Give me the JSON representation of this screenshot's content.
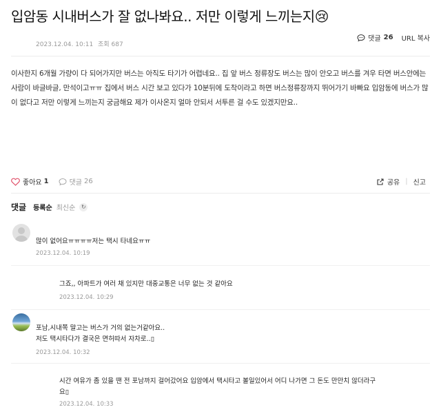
{
  "post": {
    "title": "입암동 시내버스가 잘 없나봐요.. 저만 이렇게 느끼는지😢",
    "date": "2023.12.04. 10:11",
    "views_label": "조회 687",
    "comment_label": "댓글",
    "comment_count": "26",
    "url_copy": "URL 복사",
    "body": "이사한지 6개월 가량이 다 되어가지만 버스는 아직도 타기가 어렵네요.. 집 앞 버스 정류장도 버스는 많이 안오고 버스를 겨우 타면 버스안에는 사람이 바글바글, 만석이고ㅠㅠ 집에서 버스 시간 보고 있다가 10분뒤에 도착이라고 하면 버스정류장까지 뛰어가기 바빠요 입암동에 버스가 많이 없다고 저만 이렇게 느끼는지 궁금해요 제가 이사온지 얼마 안되서 서투른 걸 수도 있겠지만요.."
  },
  "actions": {
    "like_label": "좋아요",
    "like_count": "1",
    "comment_label": "댓글",
    "comment_count": "26",
    "share_label": "공유",
    "report_label": "신고"
  },
  "comments_section": {
    "title": "댓글",
    "sort_registered": "등록순",
    "sort_latest": "최신순"
  },
  "comments": [
    {
      "text": "많이 없어요ㅠㅠㅠㅠ저는 택시 타네요ㅠㅠ",
      "date": "2023.12.04. 10:19"
    },
    {
      "text": "그죠,, 아파트가 여러 채 있지만 대중교통은 너무 없는 것 같아요",
      "date": "2023.12.04. 10:29"
    },
    {
      "text": "포남,시내쪽 말고는 버스가 거의 없는거같아요..",
      "text2": "저도 택시타다가 결국은 면허따서 자차로..▯",
      "date": "2023.12.04. 10:32"
    },
    {
      "text": "시간 여유가 좀 있을 땐 전 포남까지 걸어갔어요 입암에서 택시타고 볼일있어서 어디 나가면 그 돈도 만만치 않더라구",
      "text2": "요▯",
      "date": "2023.12.04. 10:33"
    }
  ],
  "colors": {
    "like_heart": "#e0506a",
    "muted": "#999999"
  }
}
